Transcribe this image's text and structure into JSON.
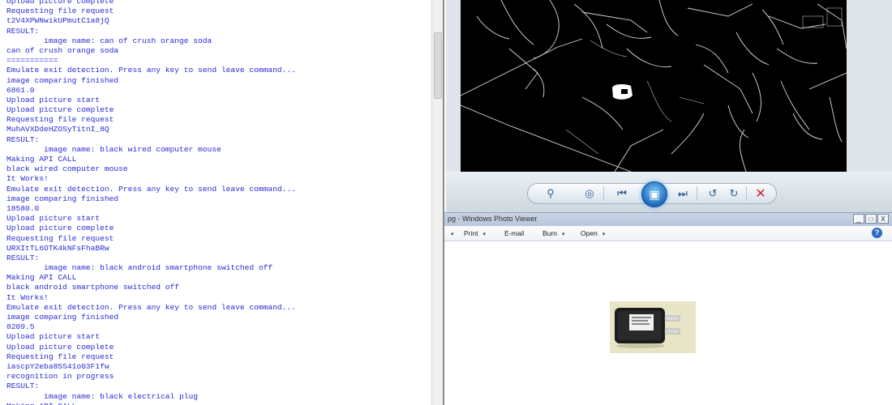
{
  "console": {
    "lines": [
      "Upload picture complete",
      "Requesting file request",
      "t2V4XPWNwikUPmutC1a8jQ",
      "RESULT:",
      "        image name: can of crush orange soda",
      "can of crush orange soda",
      "===========",
      "Emulate exit detection. Press any key to send leave command...",
      "image comparing finished",
      "6861.0",
      "Upload picture start",
      "Upload picture complete",
      "Requesting file request",
      "MuhAVXDdeHZOSyTitnI_8Q",
      "RESULT:",
      "        image name: black wired computer mouse",
      "Making API CALL",
      "black wired computer mouse",
      "It Works!",
      "Emulate exit detection. Press any key to send leave command...",
      "image comparing finished",
      "18580.0",
      "Upload picture start",
      "Upload picture complete",
      "Requesting file request",
      "URXItTL6OTK4kNFsFhaBRw",
      "RESULT:",
      "        image name: black android smartphone switched off",
      "Making API CALL",
      "black android smartphone switched off",
      "It Works!",
      "Emulate exit detection. Press any key to send leave command...",
      "image comparing finished",
      "8209.5",
      "Upload picture start",
      "Upload picture complete",
      "Requesting file request",
      "iascpY2eba85S41o03F1fw",
      "recognition in progress",
      "RESULT:",
      "        image name: black electrical plug",
      "Making API CALL"
    ]
  },
  "photo_viewer": {
    "title": "pg - Windows Photo Viewer",
    "menu": {
      "print": "Print",
      "email": "E-mail",
      "burn": "Burn",
      "open": "Open"
    },
    "window_buttons": {
      "minimize": "_",
      "maximize": "□",
      "close": "X"
    },
    "help": "?"
  },
  "toolbar_icons": [
    "zoom-icon",
    "actual-size-icon",
    "previous-icon",
    "slideshow-icon",
    "next-icon",
    "rotate-left-icon",
    "rotate-right-icon",
    "delete-icon"
  ],
  "colors": {
    "console_text": "#2a2ad6",
    "accent_blue": "#1f67b8",
    "delete_red": "#c62828"
  }
}
